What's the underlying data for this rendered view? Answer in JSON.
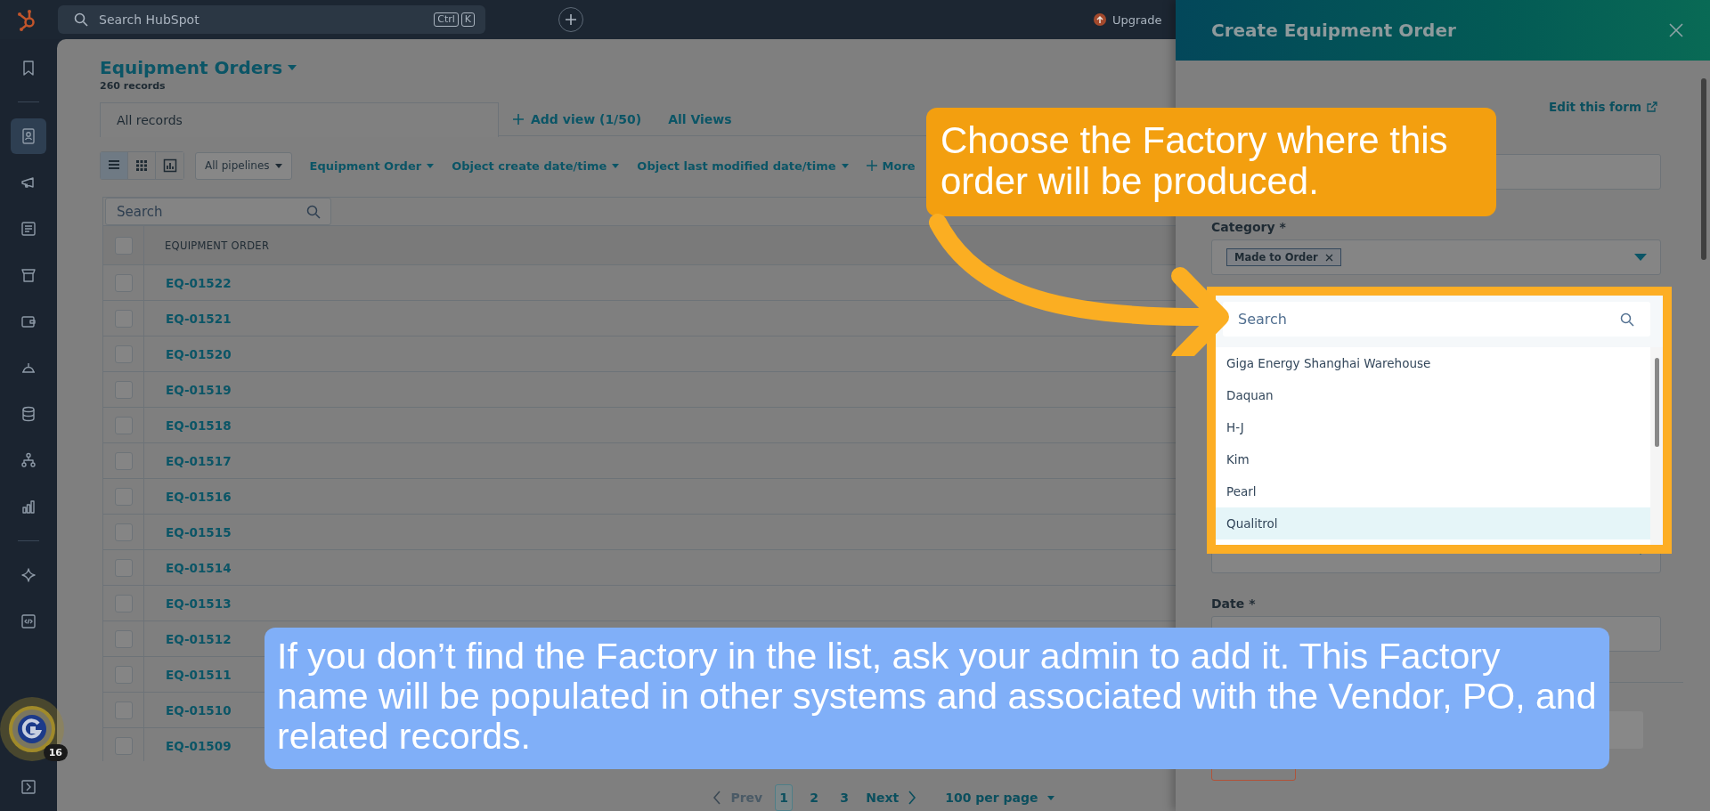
{
  "top_bar": {
    "search": {
      "placeholder": "Search HubSpot"
    },
    "shortcut_keys": [
      "Ctrl",
      "K"
    ],
    "upgrade": "Upgrade"
  },
  "sidebar": {
    "items": [
      {
        "selected": false
      },
      {
        "selected": true
      },
      {
        "selected": false
      },
      {
        "selected": false
      },
      {
        "selected": false
      },
      {
        "selected": false
      },
      {
        "selected": false
      },
      {
        "selected": false
      },
      {
        "selected": false
      },
      {
        "selected": false
      },
      {
        "selected": false
      },
      {
        "selected": false
      }
    ]
  },
  "view": {
    "title": "Equipment Orders",
    "record_count": "260 records",
    "tabs": [
      {
        "label": "All records",
        "selected": true
      }
    ],
    "add_view": "Add view (1/50)",
    "all_views": "All Views",
    "view_modes": [
      {
        "selected": true
      },
      {
        "selected": false
      },
      {
        "selected": false
      }
    ],
    "pipeline": "All pipelines",
    "filters": [
      "Equipment Order",
      "Object create date/time",
      "Object last modified date/time"
    ],
    "more": "More",
    "search": {
      "placeholder": "Search"
    }
  },
  "table": {
    "all_checked": false,
    "columns": [
      "EQUIPMENT ORDER"
    ],
    "rows": [
      {
        "order": "EQ-01522",
        "checked": false
      },
      {
        "order": "EQ-01521",
        "checked": false
      },
      {
        "order": "EQ-01520",
        "checked": false
      },
      {
        "order": "EQ-01519",
        "checked": false
      },
      {
        "order": "EQ-01518",
        "checked": false
      },
      {
        "order": "EQ-01517",
        "checked": false
      },
      {
        "order": "EQ-01516",
        "checked": false
      },
      {
        "order": "EQ-01515",
        "checked": false
      },
      {
        "order": "EQ-01514",
        "checked": false
      },
      {
        "order": "EQ-01513",
        "checked": false
      },
      {
        "order": "EQ-01512",
        "checked": false
      },
      {
        "order": "EQ-01511",
        "checked": false
      },
      {
        "order": "EQ-01510",
        "checked": false
      },
      {
        "order": "EQ-01509",
        "checked": false
      }
    ]
  },
  "pagination": {
    "prev": "Prev",
    "pages": [
      {
        "label": "1",
        "selected": true
      },
      {
        "label": "2",
        "selected": false
      },
      {
        "label": "3",
        "selected": false
      }
    ],
    "next": "Next",
    "per_page": "100 per page"
  },
  "panel": {
    "title": "Create Equipment Order",
    "edit_form": "Edit this form",
    "category": {
      "label": "Category *",
      "tags": [
        "Made to Order"
      ]
    },
    "dropdown": {
      "search": {
        "placeholder": "Search"
      },
      "options": [
        {
          "label": "Giga Energy Shanghai Warehouse",
          "selected": false
        },
        {
          "label": "Daquan",
          "selected": false
        },
        {
          "label": "H-J",
          "selected": false
        },
        {
          "label": "Kim",
          "selected": false
        },
        {
          "label": "Pearl",
          "selected": false
        },
        {
          "label": "Qualitrol",
          "selected": true
        }
      ]
    },
    "date": {
      "label": "Date *"
    }
  },
  "assistant_badge": {
    "count": "16"
  },
  "callouts": [
    {
      "text": "Choose the Factory where this order will be produced.",
      "color": "#f39f0f"
    },
    {
      "text": "If you don’t find the Factory in the list, ask your admin to add it. This Factory name will be populated in other systems and associated with the Vendor, PO, and related records.",
      "color": "#80aff8"
    }
  ]
}
